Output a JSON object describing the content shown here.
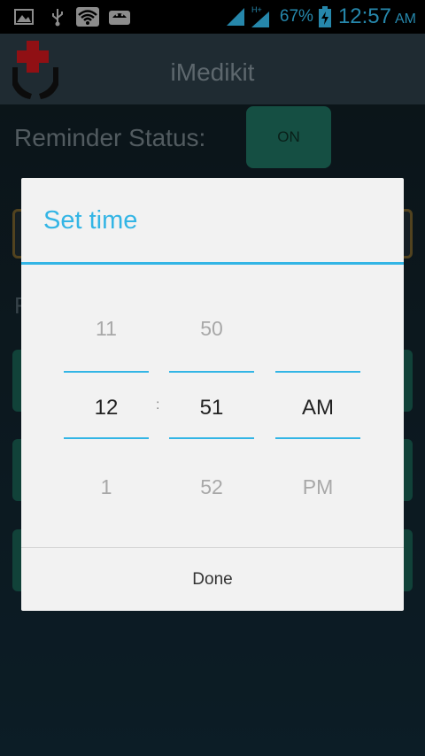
{
  "status_bar": {
    "battery_percent": "67%",
    "time": "12:57",
    "ampm": "AM",
    "icons": [
      "image-icon",
      "usb-icon",
      "wifi-icon",
      "android-icon",
      "signal-icon",
      "signal-hplus-icon",
      "battery-charging-icon"
    ],
    "network_label": "H+",
    "accent_color": "#33b5e5"
  },
  "app_bar": {
    "title": "iMedikit",
    "logo": "medical-hands-logo"
  },
  "background": {
    "reminder_label": "Reminder Status:",
    "toggle_label": "ON",
    "partial_label": "F"
  },
  "dialog": {
    "title": "Set time",
    "hour": {
      "prev": "11",
      "selected": "12",
      "next": "1"
    },
    "separator": ":",
    "minute": {
      "prev": "50",
      "selected": "51",
      "next": "52"
    },
    "ampm": {
      "selected": "AM",
      "next": "PM"
    },
    "done_label": "Done"
  }
}
